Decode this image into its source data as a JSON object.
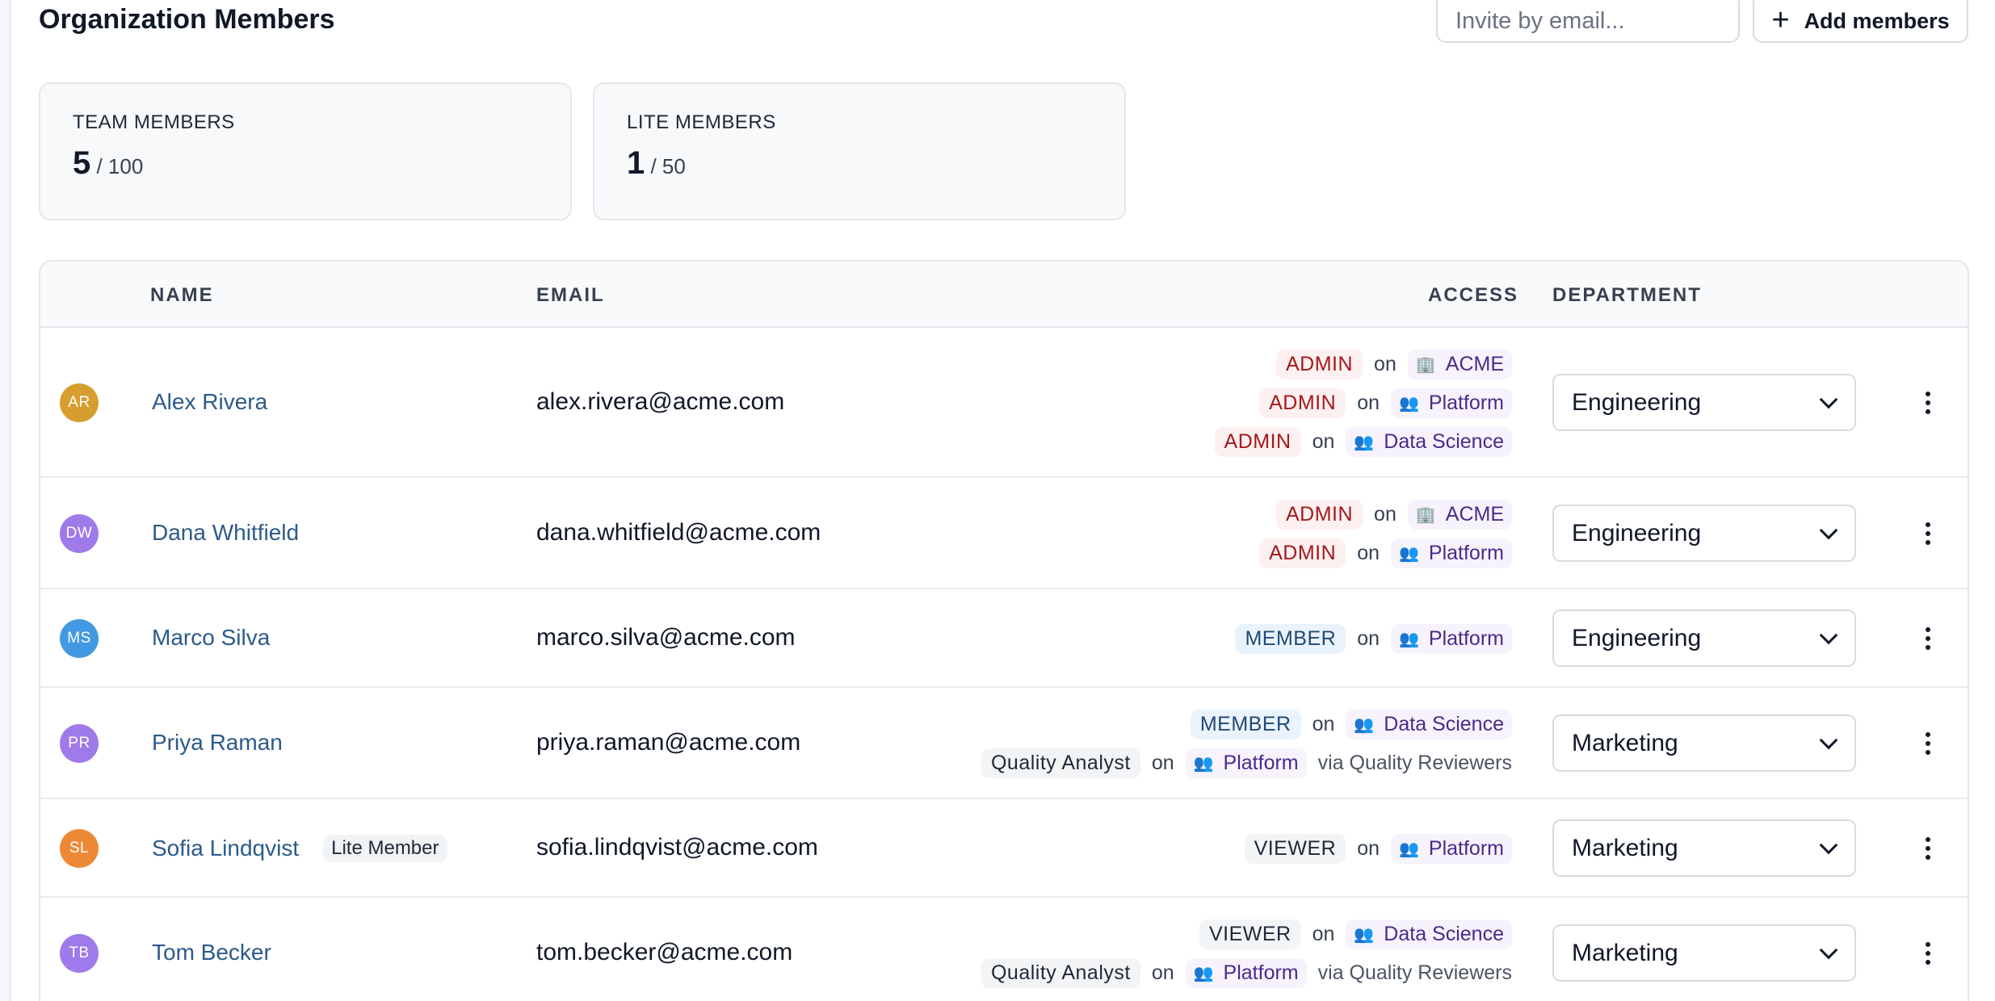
{
  "header": {
    "title": "Organization Members",
    "invite_placeholder": "Invite by email...",
    "add_members_label": "Add members",
    "add_icon": "+"
  },
  "stats": {
    "team": {
      "label": "TEAM MEMBERS",
      "count": "5",
      "limit": "/ 100"
    },
    "lite": {
      "label": "LITE MEMBERS",
      "count": "1",
      "limit": "/ 50"
    }
  },
  "table": {
    "columns": {
      "name": "NAME",
      "email": "EMAIL",
      "access": "ACCESS",
      "department": "DEPARTMENT"
    },
    "rows": [
      {
        "initials": "AR",
        "avatar_color": "#d69e2e",
        "name": "Alex Rivera",
        "badge": "",
        "email": "alex.rivera@acme.com",
        "department": "Engineering",
        "access": [
          {
            "role": "ADMIN",
            "role_type": "admin",
            "on": "on",
            "icon": "🏢",
            "target": "ACME",
            "via": ""
          },
          {
            "role": "ADMIN",
            "role_type": "admin",
            "on": "on",
            "icon": "👥",
            "target": "Platform",
            "via": ""
          },
          {
            "role": "ADMIN",
            "role_type": "admin",
            "on": "on",
            "icon": "👥",
            "target": "Data Science",
            "via": ""
          }
        ]
      },
      {
        "initials": "DW",
        "avatar_color": "#9f7aea",
        "name": "Dana Whitfield",
        "badge": "",
        "email": "dana.whitfield@acme.com",
        "department": "Engineering",
        "access": [
          {
            "role": "ADMIN",
            "role_type": "admin",
            "on": "on",
            "icon": "🏢",
            "target": "ACME",
            "via": ""
          },
          {
            "role": "ADMIN",
            "role_type": "admin",
            "on": "on",
            "icon": "👥",
            "target": "Platform",
            "via": ""
          }
        ]
      },
      {
        "initials": "MS",
        "avatar_color": "#4299e1",
        "name": "Marco Silva",
        "badge": "",
        "email": "marco.silva@acme.com",
        "department": "Engineering",
        "access": [
          {
            "role": "MEMBER",
            "role_type": "member",
            "on": "on",
            "icon": "👥",
            "target": "Platform",
            "via": ""
          }
        ]
      },
      {
        "initials": "PR",
        "avatar_color": "#9f7aea",
        "name": "Priya Raman",
        "badge": "",
        "email": "priya.raman@acme.com",
        "department": "Marketing",
        "access": [
          {
            "role": "MEMBER",
            "role_type": "member",
            "on": "on",
            "icon": "👥",
            "target": "Data Science",
            "via": ""
          },
          {
            "role": "Quality Analyst",
            "role_type": "qa",
            "on": "on",
            "icon": "👥",
            "target": "Platform",
            "via": "via Quality Reviewers"
          }
        ]
      },
      {
        "initials": "SL",
        "avatar_color": "#ed8936",
        "name": "Sofia Lindqvist",
        "badge": "Lite Member",
        "email": "sofia.lindqvist@acme.com",
        "department": "Marketing",
        "access": [
          {
            "role": "VIEWER",
            "role_type": "viewer",
            "on": "on",
            "icon": "👥",
            "target": "Platform",
            "via": ""
          }
        ]
      },
      {
        "initials": "TB",
        "avatar_color": "#9f7aea",
        "name": "Tom Becker",
        "badge": "",
        "email": "tom.becker@acme.com",
        "department": "Marketing",
        "access": [
          {
            "role": "VIEWER",
            "role_type": "viewer",
            "on": "on",
            "icon": "👥",
            "target": "Data Science",
            "via": ""
          },
          {
            "role": "Quality Analyst",
            "role_type": "qa",
            "on": "on",
            "icon": "👥",
            "target": "Platform",
            "via": "via Quality Reviewers"
          }
        ]
      }
    ]
  }
}
